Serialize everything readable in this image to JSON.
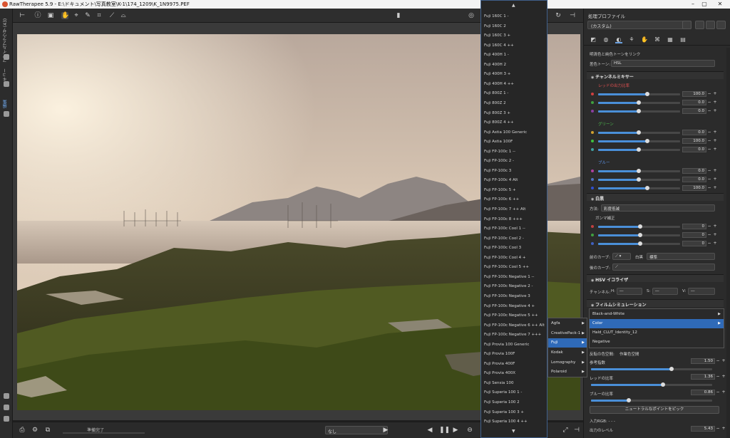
{
  "window": {
    "title": "RawTherapee 5.9 - E:\\ドキュメント\\写真教室\\K-1\\174_1209\\K_1N9975.PEF",
    "minimize": "–",
    "maximize": "▢",
    "close": "✕"
  },
  "left_tabs": [
    "ファイルブラウザ (43)",
    "キュー",
    "編集"
  ],
  "status": {
    "text": "準備完了",
    "profile": "なし"
  },
  "right_panel": {
    "header": "処理プロファイル",
    "profile_value": "(カスタム)",
    "colortoning": {
      "checkbox_label": "明清色と純色トーンをリンク",
      "method_label": "差色トーン:",
      "method_value": "HSL"
    },
    "channel_mixer": {
      "title": "チャンネルミキサー",
      "red_label": "レッドの出力比率",
      "green_label": "グリーン",
      "blue_label": "ブルー",
      "values": [
        "100.0",
        "0.0",
        "0.0",
        "0.0",
        "100.0",
        "0.0",
        "0.0",
        "0.0",
        "100.0"
      ]
    },
    "bw": {
      "title": "白黒",
      "method_label": "方法:",
      "method_value": "彩度低減",
      "gamma_label": "ガンマ補正",
      "gamma_values": [
        "0",
        "0",
        "0"
      ],
      "before_curve": "前のカーブ:",
      "before_curve_mode": "白黒",
      "before_curve_value": "標準",
      "after_curve": "後のカーブ:"
    },
    "hsv": {
      "title": "HSV イコライザ",
      "channel_label": "チャンネル:",
      "h": "H:",
      "s": "S:",
      "v": "V:"
    },
    "film": {
      "title": "フィルムシミュレーション",
      "working_space_label": "作業色空間",
      "working_space_prefix": "反転の色空間:",
      "ref_label": "参考指数",
      "ref_value": "1.50",
      "red_ratio_label": "レッドの比率",
      "red_ratio_value": "1.36",
      "blue_ratio_label": "ブルーの比率",
      "blue_ratio_value": "0.86",
      "neutral_button": "ニュートラルなポイントをピック",
      "input_rgb": "入力RGB: - - -",
      "output_level": "出力のレベル",
      "output_value": "5.43"
    }
  },
  "fuji_list": [
    "Fuji 160C 1 -",
    "Fuji 160C 2",
    "Fuji 160C 3 +",
    "Fuji 160C 4 ++",
    "Fuji 400H 1 -",
    "Fuji 400H 2",
    "Fuji 400H 3 +",
    "Fuji 400H 4 ++",
    "Fuji 800Z 1 -",
    "Fuji 800Z 2",
    "Fuji 800Z 3 +",
    "Fuji 800Z 4 ++",
    "Fuji Astia 100 Generic",
    "Fuji Astia 100F",
    "Fuji FP-100c 1 --",
    "Fuji FP-100c 2 -",
    "Fuji FP-100c 3",
    "Fuji FP-100c 4 Alt",
    "Fuji FP-100c 5 +",
    "Fuji FP-100c 6 ++",
    "Fuji FP-100c 7 ++ Alt",
    "Fuji FP-100c 8 +++",
    "Fuji FP-100c Cool 1 --",
    "Fuji FP-100c Cool 2 -",
    "Fuji FP-100c Cool 3",
    "Fuji FP-100c Cool 4 +",
    "Fuji FP-100c Cool 5 ++",
    "Fuji FP-100c Negative 1 --",
    "Fuji FP-100c Negative 2 -",
    "Fuji FP-100c Negative 3",
    "Fuji FP-100c Negative 4 +",
    "Fuji FP-100c Negative 5 ++",
    "Fuji FP-100c Negative 6 ++ Alt",
    "Fuji FP-100c Negative 7 +++",
    "Fuji Provia 100 Generic",
    "Fuji Provia 100F",
    "Fuji Provia 400F",
    "Fuji Provia 400X",
    "Fuji Sensia 100",
    "Fuji Superia 100 1 -",
    "Fuji Superia 100 2",
    "Fuji Superia 100 3 +",
    "Fuji Superia 100 4 ++"
  ],
  "category_menu": [
    "Agfa",
    "CreativePack-1",
    "Fuji",
    "Kodak",
    "Lomography",
    "Polaroid"
  ],
  "film_menu": [
    "Black-and-White",
    "Color",
    "Hald_CLUT_Identity_12",
    "Negative"
  ]
}
